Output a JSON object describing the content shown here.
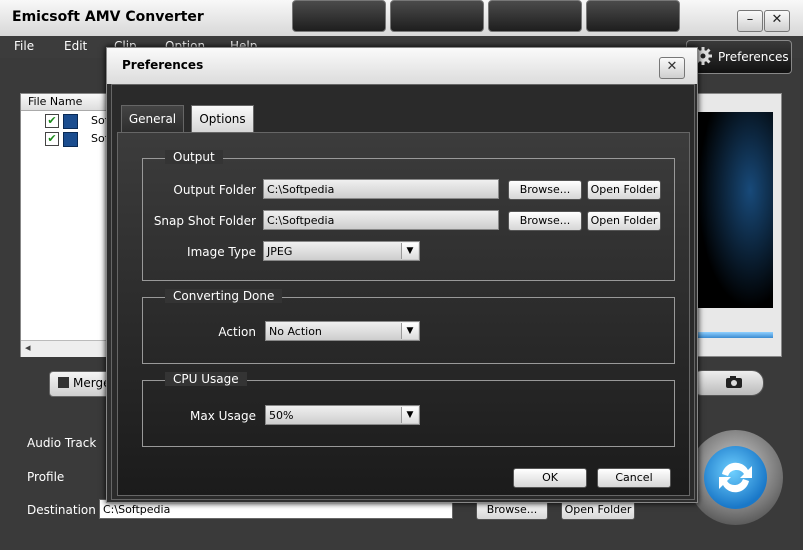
{
  "app": {
    "title": "Emicsoft AMV Converter",
    "minimize": "–",
    "close": "✕"
  },
  "menu": [
    "File",
    "Edit",
    "Clip",
    "Option",
    "Help"
  ],
  "toolbar": {
    "preferences_label": "Preferences"
  },
  "filelist": {
    "header": "File Name",
    "rows": [
      {
        "name": "Sof",
        "checked": true
      },
      {
        "name": "Sof",
        "checked": true
      }
    ]
  },
  "merge_label": "Merge",
  "bottom": {
    "audio_track_label": "Audio Track",
    "profile_label": "Profile",
    "destination_label": "Destination",
    "destination_value": "C:\\Softpedia",
    "browse_label": "Browse...",
    "open_folder_label": "Open Folder"
  },
  "dialog": {
    "title": "Preferences",
    "close": "✕",
    "tabs": {
      "general": "General",
      "options": "Options"
    },
    "output": {
      "group_label": "Output",
      "output_folder_label": "Output Folder",
      "output_folder_value": "C:\\Softpedia",
      "snapshot_folder_label": "Snap Shot Folder",
      "snapshot_folder_value": "C:\\Softpedia",
      "image_type_label": "Image Type",
      "image_type_value": "JPEG",
      "browse_label": "Browse...",
      "open_folder_label": "Open Folder"
    },
    "converting_done": {
      "group_label": "Converting Done",
      "action_label": "Action",
      "action_value": "No Action"
    },
    "cpu": {
      "group_label": "CPU Usage",
      "max_usage_label": "Max Usage",
      "max_usage_value": "50%"
    },
    "ok_label": "OK",
    "cancel_label": "Cancel"
  }
}
